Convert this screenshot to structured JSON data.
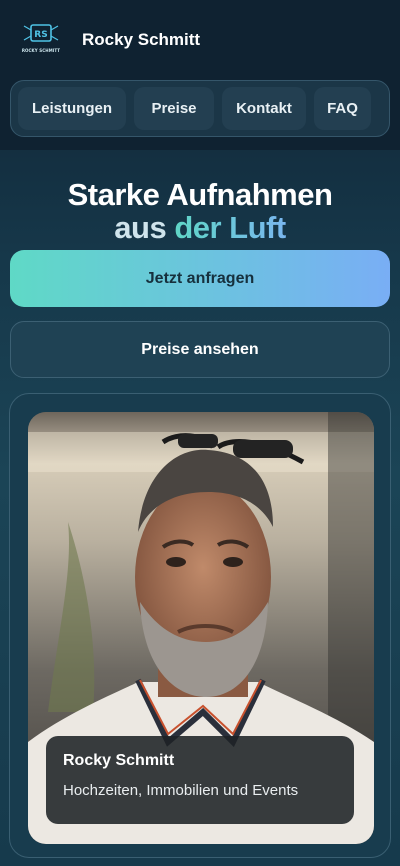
{
  "header": {
    "logo_text": "ROCKY SCHMITT",
    "brand_name": "Rocky Schmitt"
  },
  "nav": {
    "items": [
      {
        "label": "Leistungen"
      },
      {
        "label": "Preise"
      },
      {
        "label": "Kontakt"
      },
      {
        "label": "FAQ"
      }
    ]
  },
  "hero": {
    "title_line1": "Starke Aufnahmen",
    "title_line2_prefix": "aus ",
    "title_line2_accent": "der Luft",
    "primary_cta": "Jetzt anfragen",
    "secondary_cta": "Preise ansehen"
  },
  "portrait": {
    "name": "Rocky Schmitt",
    "subtitle": "Hochzeiten, Immobilien und Events"
  },
  "colors": {
    "header_bg": "#0f2231",
    "accent_from": "#5fd9c6",
    "accent_to": "#79aef5"
  }
}
